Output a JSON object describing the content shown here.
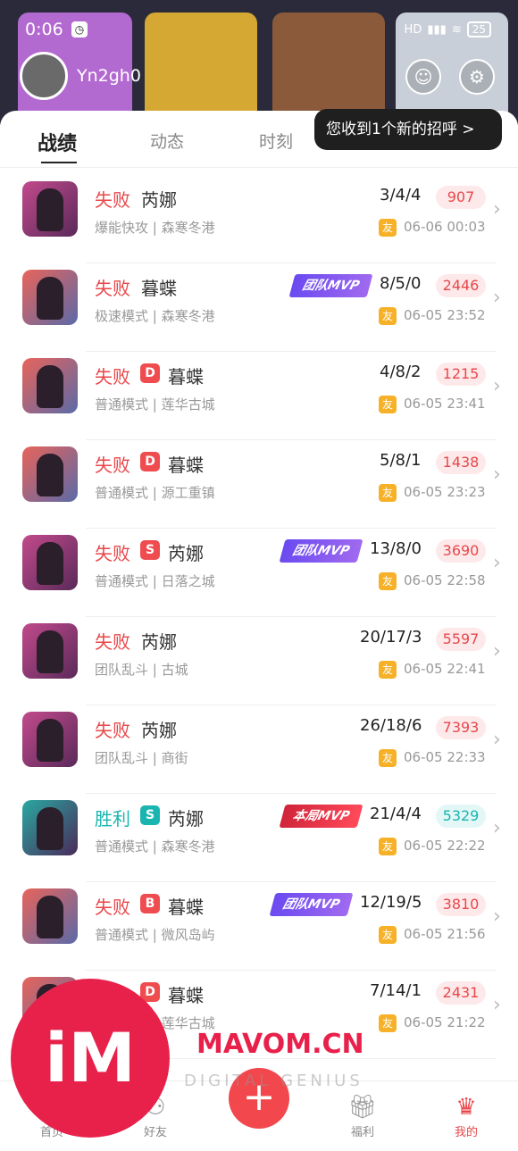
{
  "status_bar": {
    "time": "0:06",
    "battery": "25",
    "network": "HD"
  },
  "profile": {
    "username": "Yn2gh0"
  },
  "tabs": [
    {
      "label": "战绩",
      "active": true
    },
    {
      "label": "动态"
    },
    {
      "label": "时刻"
    }
  ],
  "tooltip": "您收到1个新的招呼 >",
  "matches": [
    {
      "result": "失败",
      "rank": "",
      "hero": "芮娜",
      "mode": "爆能快攻 | 森寒冬港",
      "mvp": "",
      "kda": "3/4/4",
      "score": "907",
      "time": "06-06 00:03",
      "icon": "reyna"
    },
    {
      "result": "失败",
      "rank": "",
      "hero": "暮蝶",
      "mode": "极速模式 | 森寒冬港",
      "mvp": "团队MVP",
      "kda": "8/5/0",
      "score": "2446",
      "time": "06-05 23:52",
      "icon": "dd"
    },
    {
      "result": "失败",
      "rank": "D",
      "hero": "暮蝶",
      "mode": "普通模式 | 莲华古城",
      "mvp": "",
      "kda": "4/8/2",
      "score": "1215",
      "time": "06-05 23:41",
      "icon": "dd"
    },
    {
      "result": "失败",
      "rank": "D",
      "hero": "暮蝶",
      "mode": "普通模式 | 源工重镇",
      "mvp": "",
      "kda": "5/8/1",
      "score": "1438",
      "time": "06-05 23:23",
      "icon": "dd"
    },
    {
      "result": "失败",
      "rank": "S",
      "hero": "芮娜",
      "mode": "普通模式 | 日落之城",
      "mvp": "团队MVP",
      "kda": "13/8/0",
      "score": "3690",
      "time": "06-05 22:58",
      "icon": "reyna"
    },
    {
      "result": "失败",
      "rank": "",
      "hero": "芮娜",
      "mode": "团队乱斗 | 古城",
      "mvp": "",
      "kda": "20/17/3",
      "score": "5597",
      "time": "06-05 22:41",
      "icon": "reyna"
    },
    {
      "result": "失败",
      "rank": "",
      "hero": "芮娜",
      "mode": "团队乱斗 | 商街",
      "mvp": "",
      "kda": "26/18/6",
      "score": "7393",
      "time": "06-05 22:33",
      "icon": "reyna"
    },
    {
      "result": "胜利",
      "rank": "S",
      "hero": "芮娜",
      "mode": "普通模式 | 森寒冬港",
      "mvp": "本局MVP",
      "kda": "21/4/4",
      "score": "5329",
      "time": "06-05 22:22",
      "icon": "win"
    },
    {
      "result": "失败",
      "rank": "B",
      "hero": "暮蝶",
      "mode": "普通模式 | 微风岛屿",
      "mvp": "团队MVP",
      "kda": "12/19/5",
      "score": "3810",
      "time": "06-05 21:56",
      "icon": "dd"
    },
    {
      "result": "失败",
      "rank": "D",
      "hero": "暮蝶",
      "mode": "普通模式 | 莲华古城",
      "mvp": "",
      "kda": "7/14/1",
      "score": "2431",
      "time": "06-05 21:22",
      "icon": "dd"
    }
  ],
  "you_badge": "友",
  "bottom_nav": [
    {
      "label": "首页",
      "icon": "home-icon"
    },
    {
      "label": "好友",
      "icon": "friends-icon"
    },
    {
      "label": "福利",
      "icon": "gift-icon"
    },
    {
      "label": "我的",
      "icon": "profile-icon",
      "active": true
    }
  ],
  "fab": "+",
  "watermark": {
    "logo": "iM",
    "site": "MAVOM.CN",
    "tagline": "DIGITAL GENIUS"
  },
  "colors": {
    "lose": "#e8474a",
    "win": "#1ab5b0",
    "accent": "#f2474d"
  }
}
